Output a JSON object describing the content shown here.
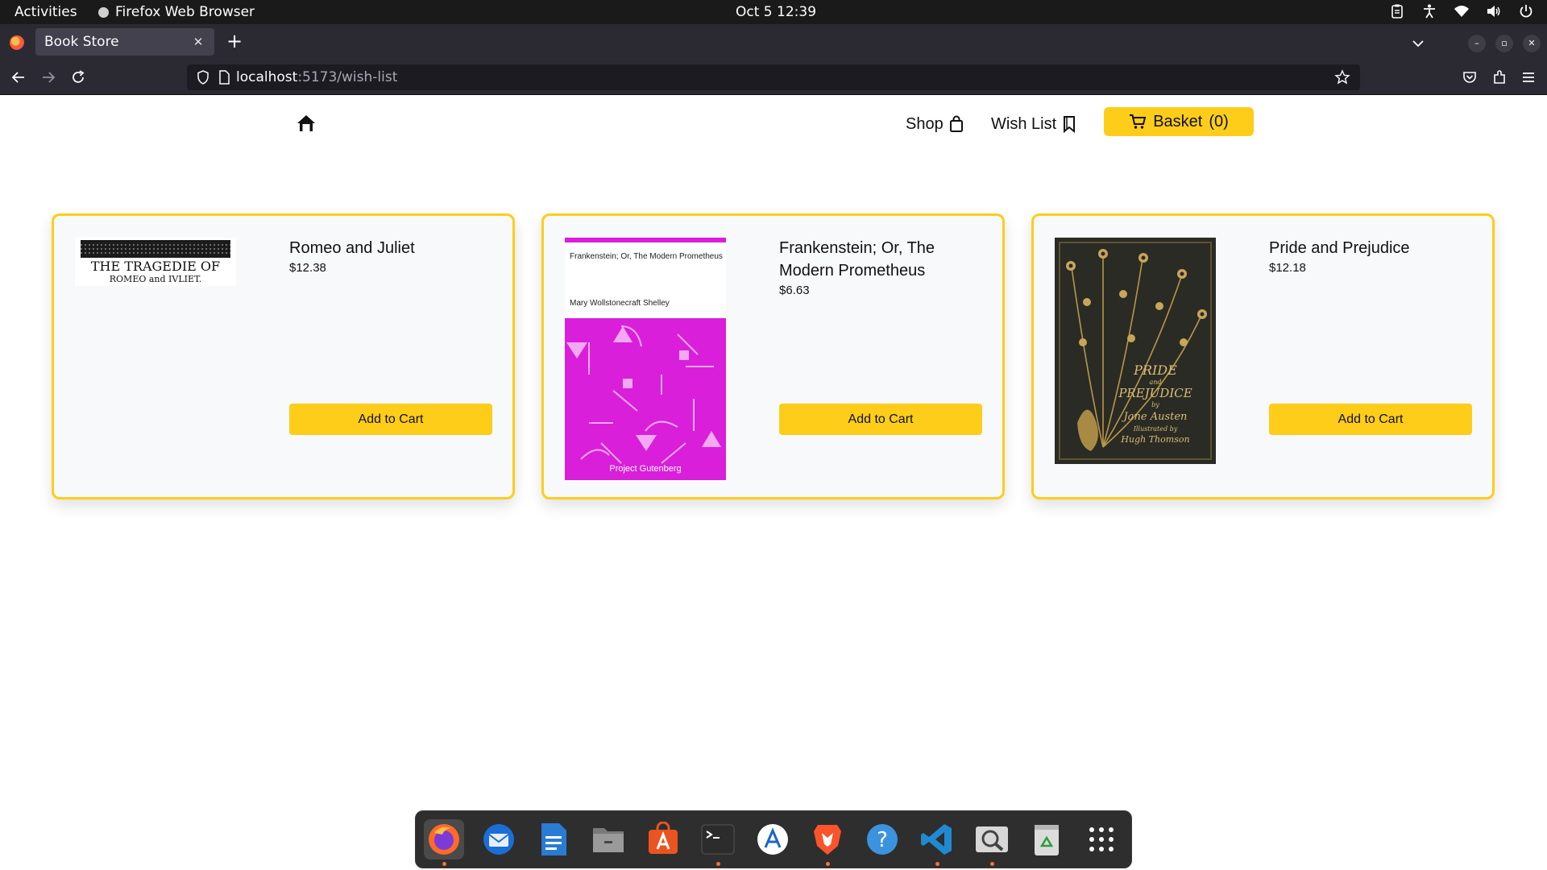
{
  "system": {
    "activities": "Activities",
    "app_name": "Firefox Web Browser",
    "clock": "Oct 5  12:39"
  },
  "browser": {
    "tab_title": "Book Store",
    "url_host": "localhost",
    "url_rest": ":5173/wish-list"
  },
  "header": {
    "shop_label": "Shop",
    "wishlist_label": "Wish List",
    "basket_label": "Basket",
    "basket_count": "(0)"
  },
  "books": [
    {
      "title": "Romeo and Juliet",
      "price": "$12.38",
      "button": "Add to Cart",
      "cover_line1": "THE TRAGEDIE OF",
      "cover_line2": "ROMEO and IVLIET."
    },
    {
      "title": "Frankenstein; Or, The Modern Prometheus",
      "price": "$6.63",
      "button": "Add to Cart",
      "cover_title": "Frankenstein; Or, The Modern Prometheus",
      "cover_author": "Mary Wollstonecraft Shelley",
      "cover_publisher": "Project Gutenberg"
    },
    {
      "title": "Pride and Prejudice",
      "price": "$12.18",
      "button": "Add to Cart",
      "cover_title_1": "PRIDE",
      "cover_and": "and",
      "cover_title_2": "PREJUDICE",
      "cover_by": "by",
      "cover_author": "Jane Austen",
      "cover_illustrated": "Illustrated by",
      "cover_illustrator": "Hugh Thomson"
    }
  ],
  "dock": [
    {
      "name": "firefox-icon"
    },
    {
      "name": "thunderbird-icon"
    },
    {
      "name": "libreoffice-writer-icon"
    },
    {
      "name": "files-icon"
    },
    {
      "name": "software-store-icon"
    },
    {
      "name": "terminal-icon"
    },
    {
      "name": "app-center-icon"
    },
    {
      "name": "brave-icon"
    },
    {
      "name": "help-icon"
    },
    {
      "name": "vscode-icon"
    },
    {
      "name": "image-viewer-icon"
    },
    {
      "name": "trash-icon"
    },
    {
      "name": "show-apps-icon"
    }
  ],
  "colors": {
    "accent": "#fecd1a",
    "card_bg": "#f8f9fa",
    "frankenstein_magenta": "#d91fd9"
  }
}
